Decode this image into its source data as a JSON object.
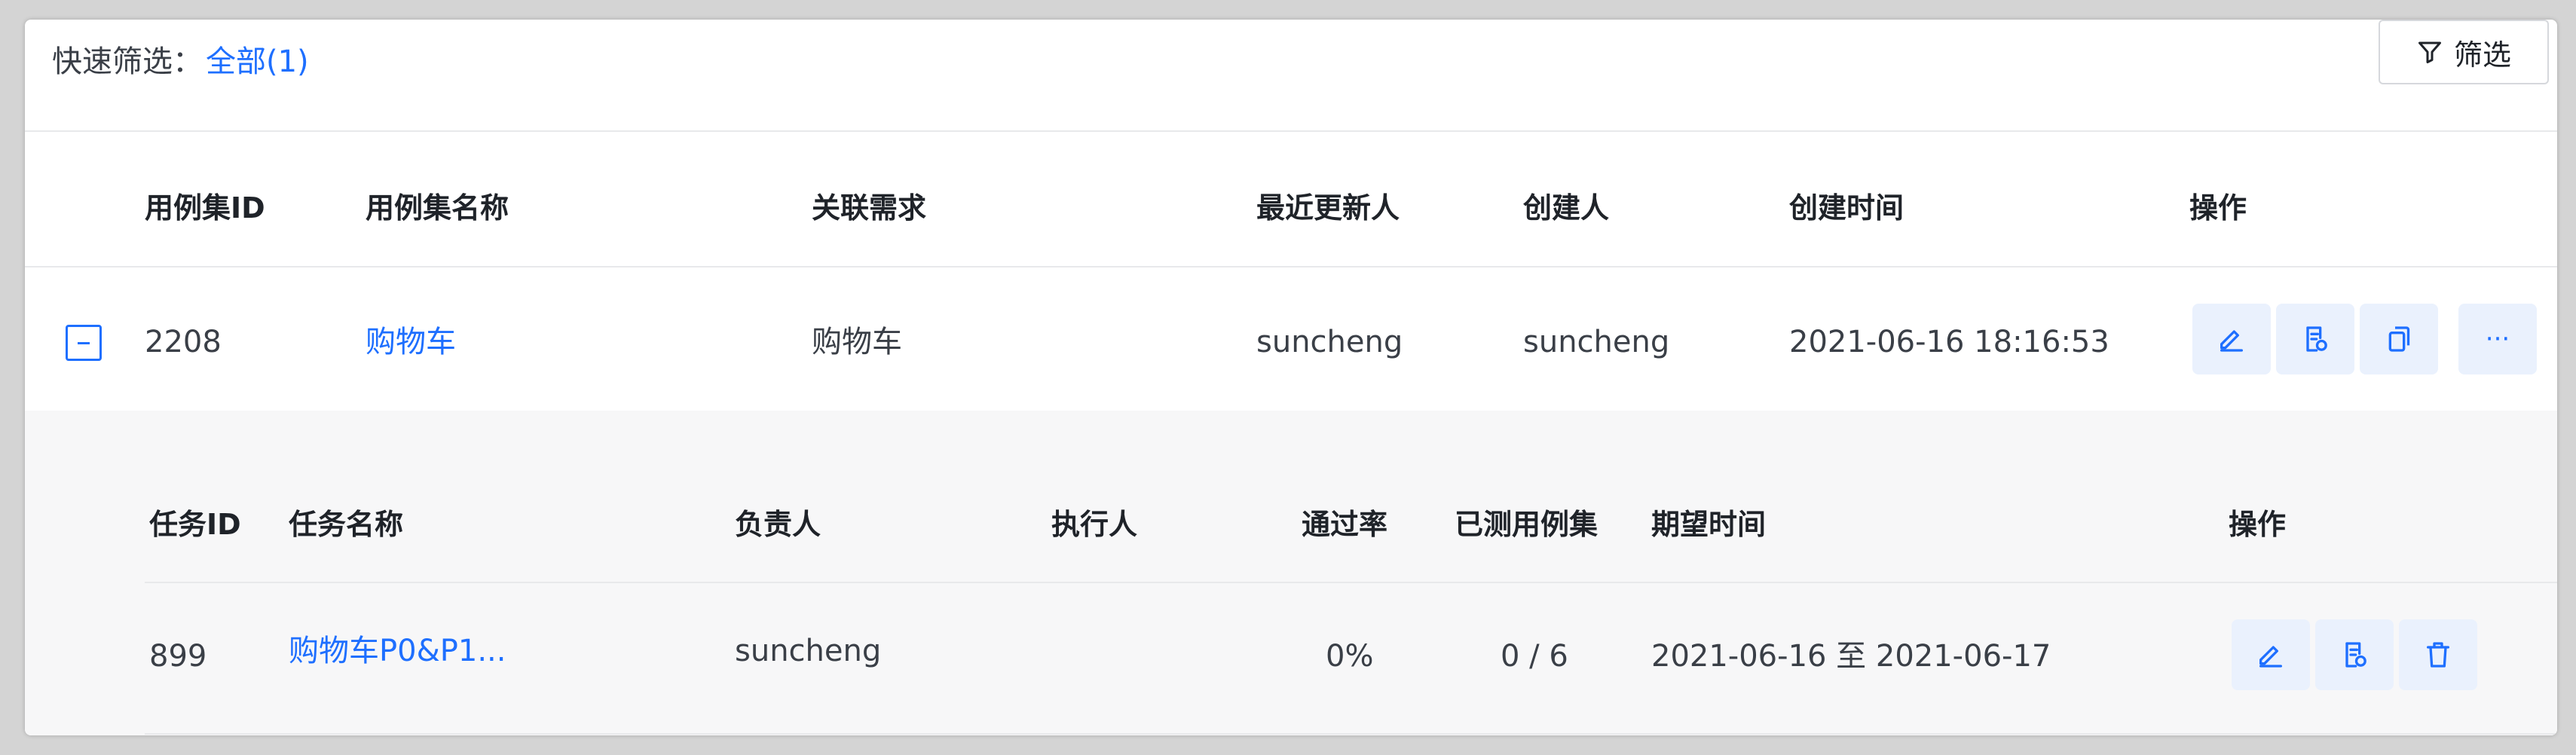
{
  "quick_filter": {
    "label": "快速筛选：",
    "all": "全部(1)"
  },
  "filter_button": {
    "label": "筛选"
  },
  "main_table": {
    "headers": [
      "用例集ID",
      "用例集名称",
      "关联需求",
      "最近更新人",
      "创建人",
      "创建时间",
      "操作"
    ],
    "row": {
      "id": "2208",
      "name": "购物车",
      "requirement": "购物车",
      "updated_by": "suncheng",
      "creator": "suncheng",
      "created_at": "2021-06-16 18:16:53",
      "more": "···"
    }
  },
  "sub_table": {
    "headers": [
      "任务ID",
      "任务名称",
      "负责人",
      "执行人",
      "通过率",
      "已测用例集",
      "期望时间",
      "操作"
    ],
    "row": {
      "id": "899",
      "name": "购物车P0&P1...",
      "owner": "suncheng",
      "executor": "",
      "pass_rate": "0%",
      "tested": "0 / 6",
      "expected_time": "2021-06-16 至 2021-06-17"
    }
  },
  "colors": {
    "accent": "#1e6fff",
    "icon_bg": "#eaf1fd",
    "sub_bg": "#f7f7f8"
  },
  "icons": [
    "filter-icon",
    "edit-icon",
    "document-icon",
    "copy-icon",
    "more-icon",
    "trash-icon"
  ]
}
